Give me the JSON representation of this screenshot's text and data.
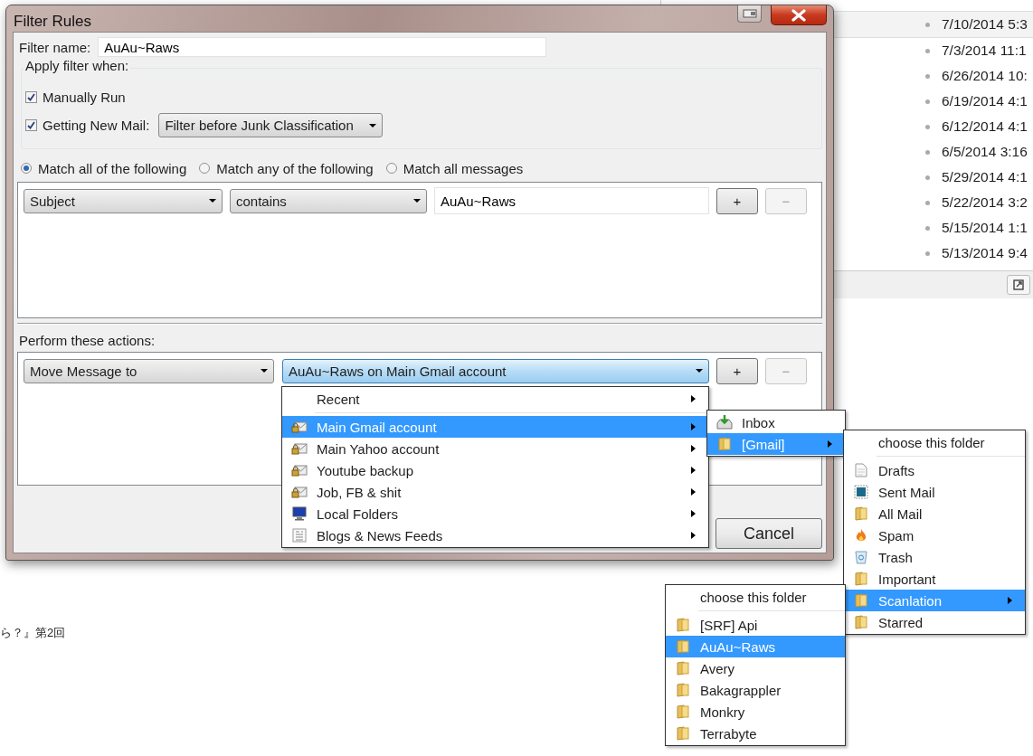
{
  "window": {
    "title": "Filter Rules"
  },
  "filter_name": {
    "label": "Filter name:",
    "value": "AuAu~Raws"
  },
  "apply_when": {
    "label": "Apply filter when:",
    "options": [
      {
        "label": "Manually Run",
        "checked": true
      },
      {
        "label": "Getting New Mail:",
        "checked": true
      }
    ],
    "junk_dropdown": "Filter before Junk Classification"
  },
  "match_options": [
    {
      "label": "Match all of the following",
      "selected": true
    },
    {
      "label": "Match any of the following",
      "selected": false
    },
    {
      "label": "Match all messages",
      "selected": false
    }
  ],
  "conditions": [
    {
      "field": "Subject",
      "operator": "contains",
      "value": "AuAu~Raws",
      "add": "+",
      "remove": "−",
      "remove_disabled": true
    }
  ],
  "actions_label": "Perform these actions:",
  "actions": [
    {
      "action": "Move Message to",
      "target": "AuAu~Raws on Main Gmail account",
      "open": true,
      "add": "+",
      "remove": "−",
      "remove_disabled": true
    }
  ],
  "buttons": [
    {
      "label": "Cancel"
    }
  ],
  "menus": [
    {
      "items": [
        {
          "label": "Recent",
          "kind": "none",
          "selected": false,
          "submenu": true,
          "separator_after": true
        },
        {
          "label": "Main Gmail account",
          "kind": "account",
          "selected": true,
          "submenu": true
        },
        {
          "label": "Main Yahoo account",
          "kind": "account",
          "selected": false,
          "submenu": true
        },
        {
          "label": "Youtube backup",
          "kind": "account",
          "selected": false,
          "submenu": true
        },
        {
          "label": "Job, FB & shit",
          "kind": "account",
          "selected": false,
          "submenu": true
        },
        {
          "label": "Local Folders",
          "kind": "computer",
          "selected": false,
          "submenu": true
        },
        {
          "label": "Blogs & News Feeds",
          "kind": "feeds",
          "selected": false,
          "submenu": true
        }
      ]
    },
    {
      "items": [
        {
          "label": "Inbox",
          "kind": "inbox",
          "selected": false,
          "submenu": false
        },
        {
          "label": "[Gmail]",
          "kind": "folder",
          "selected": true,
          "submenu": true
        }
      ]
    },
    {
      "items": [
        {
          "label": "choose this folder",
          "kind": "none",
          "selected": false,
          "submenu": false,
          "separator_after": true
        },
        {
          "label": "Drafts",
          "kind": "drafts",
          "selected": false,
          "submenu": false
        },
        {
          "label": "Sent Mail",
          "kind": "sent",
          "selected": false,
          "submenu": false
        },
        {
          "label": "All Mail",
          "kind": "folder",
          "selected": false,
          "submenu": false
        },
        {
          "label": "Spam",
          "kind": "spam",
          "selected": false,
          "submenu": false
        },
        {
          "label": "Trash",
          "kind": "trash",
          "selected": false,
          "submenu": false
        },
        {
          "label": "Important",
          "kind": "folder",
          "selected": false,
          "submenu": false
        },
        {
          "label": "Scanlation",
          "kind": "folder",
          "selected": true,
          "submenu": true
        },
        {
          "label": "Starred",
          "kind": "folder",
          "selected": false,
          "submenu": false
        }
      ]
    },
    {
      "items": [
        {
          "label": "choose this folder",
          "kind": "none",
          "selected": false,
          "submenu": false,
          "separator_after": true
        },
        {
          "label": "[SRF] Api",
          "kind": "folder",
          "selected": false,
          "submenu": false
        },
        {
          "label": "AuAu~Raws",
          "kind": "folder",
          "selected": true,
          "submenu": false
        },
        {
          "label": "Avery",
          "kind": "folder",
          "selected": false,
          "submenu": false
        },
        {
          "label": "Bakagrappler",
          "kind": "folder",
          "selected": false,
          "submenu": false
        },
        {
          "label": "Monkry",
          "kind": "folder",
          "selected": false,
          "submenu": false
        },
        {
          "label": "Terrabyte",
          "kind": "folder",
          "selected": false,
          "submenu": false
        }
      ]
    }
  ],
  "background": {
    "dates": [
      "7/10/2014 5:3",
      "7/3/2014 11:1",
      "6/26/2014 10:",
      "6/19/2014 4:1",
      "6/12/2014 4:1",
      "6/5/2014 3:16",
      "5/29/2014 4:1",
      "5/22/2014 3:2",
      "5/15/2014 1:1",
      "5/13/2014 9:4"
    ],
    "fragment": "ら？』第2回"
  }
}
